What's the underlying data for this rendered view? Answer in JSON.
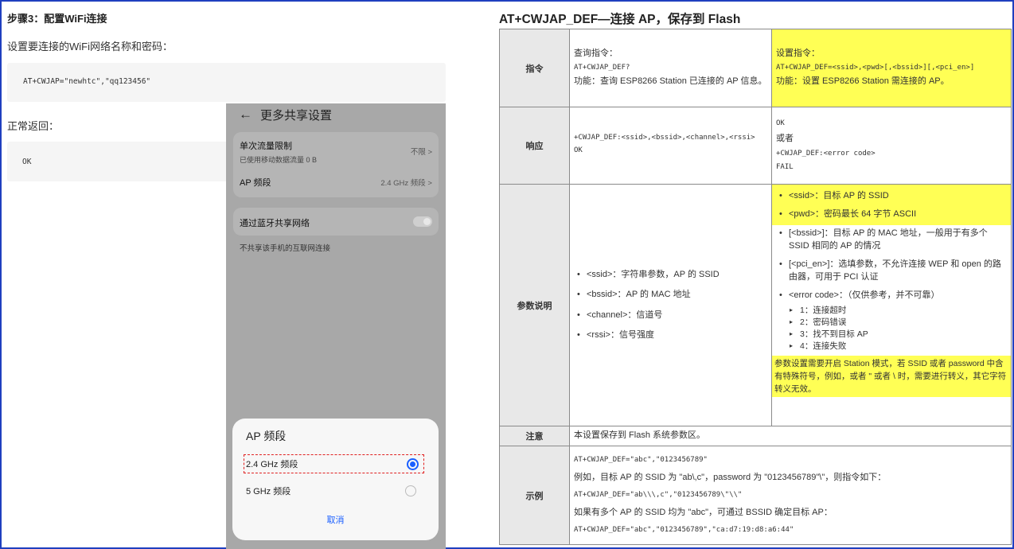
{
  "left": {
    "step_title": "步骤3：配置WiFi连接",
    "intro": "设置要连接的WiFi网络名称和密码：",
    "code": "AT+CWJAP=\"newhtc\",\"qq123456\"",
    "return_label": "正常返回：",
    "return_code": "OK"
  },
  "phone": {
    "back_icon": "back-arrow",
    "title": "更多共享设置",
    "rows": [
      {
        "title": "单次流量限制",
        "sub": "已使用移动数据流量 0 B",
        "value": "不限 >"
      },
      {
        "title": "AP 频段",
        "value": "2.4 GHz 频段 >"
      }
    ],
    "bluetooth_label": "通过蓝牙共享网络",
    "bluetooth_enabled": false,
    "note": "不共享该手机的互联网连接",
    "sheet": {
      "title": "AP 频段",
      "options": [
        {
          "label": "2.4 GHz 频段",
          "selected": true
        },
        {
          "label": "5 GHz 频段",
          "selected": false
        }
      ],
      "cancel": "取消"
    }
  },
  "spec": {
    "title": "AT+CWJAP_DEF—连接 AP，保存到 Flash",
    "rows": {
      "command": {
        "label": "指令",
        "query_title": "查询指令：",
        "query_cmd": "AT+CWJAP_DEF?",
        "query_desc": "功能：查询 ESP8266 Station 已连接的 AP 信息。",
        "set_title": "设置指令：",
        "set_cmd": "AT+CWJAP_DEF=<ssid>,<pwd>[,<bssid>][,<pci_en>]",
        "set_desc": "功能：设置 ESP8266 Station 需连接的 AP。"
      },
      "response": {
        "label": "响应",
        "query_resp_1": "+CWJAP_DEF:<ssid>,<bssid>,<channel>,<rssi>",
        "query_resp_2": "OK",
        "set_resp_1": "OK",
        "set_resp_2": "或者",
        "set_resp_3": "+CWJAP_DEF:<error code>",
        "set_resp_4": "FAIL"
      },
      "params": {
        "label": "参数说明",
        "query_params": [
          "<ssid>：字符串参数，AP 的 SSID",
          "<bssid>：AP 的 MAC 地址",
          "<channel>：信道号",
          "<rssi>：信号强度"
        ],
        "set_params_yellow": [
          "<ssid>：目标 AP 的 SSID",
          "<pwd>：密码最长 64 字节 ASCII"
        ],
        "set_params": [
          "[<bssid>]：目标 AP 的 MAC 地址，一般用于有多个 SSID 相同的 AP 的情况",
          "[<pci_en>]：选填参数，不允许连接 WEP 和 open 的路由器，可用于 PCI 认证",
          "<error code>：（仅供参考，并不可靠）"
        ],
        "error_codes": [
          "1：连接超时",
          "2：密码错误",
          "3：找不到目标 AP",
          "4：连接失败"
        ],
        "set_note": "参数设置需要开启 Station 模式，若 SSID 或者 password 中含有特殊符号，例如，或者 \" 或者 \\ 时，需要进行转义，其它字符转义无效。"
      },
      "notice": {
        "label": "注意",
        "text": "本设置保存到 Flash 系统参数区。"
      },
      "example": {
        "label": "示例",
        "lines": [
          "AT+CWJAP_DEF=\"abc\",\"0123456789\"",
          "例如，目标 AP 的 SSID 为 \"ab\\,c\"，password 为 \"0123456789\"\\\"，则指令如下：",
          "AT+CWJAP_DEF=\"ab\\\\\\,c\",\"0123456789\\\"\\\\\"",
          "如果有多个 AP 的 SSID 均为 \"abc\"，可通过 BSSID 确定目标 AP：",
          "AT+CWJAP_DEF=\"abc\",\"0123456789\",\"ca:d7:19:d8:a6:44\""
        ]
      }
    }
  }
}
